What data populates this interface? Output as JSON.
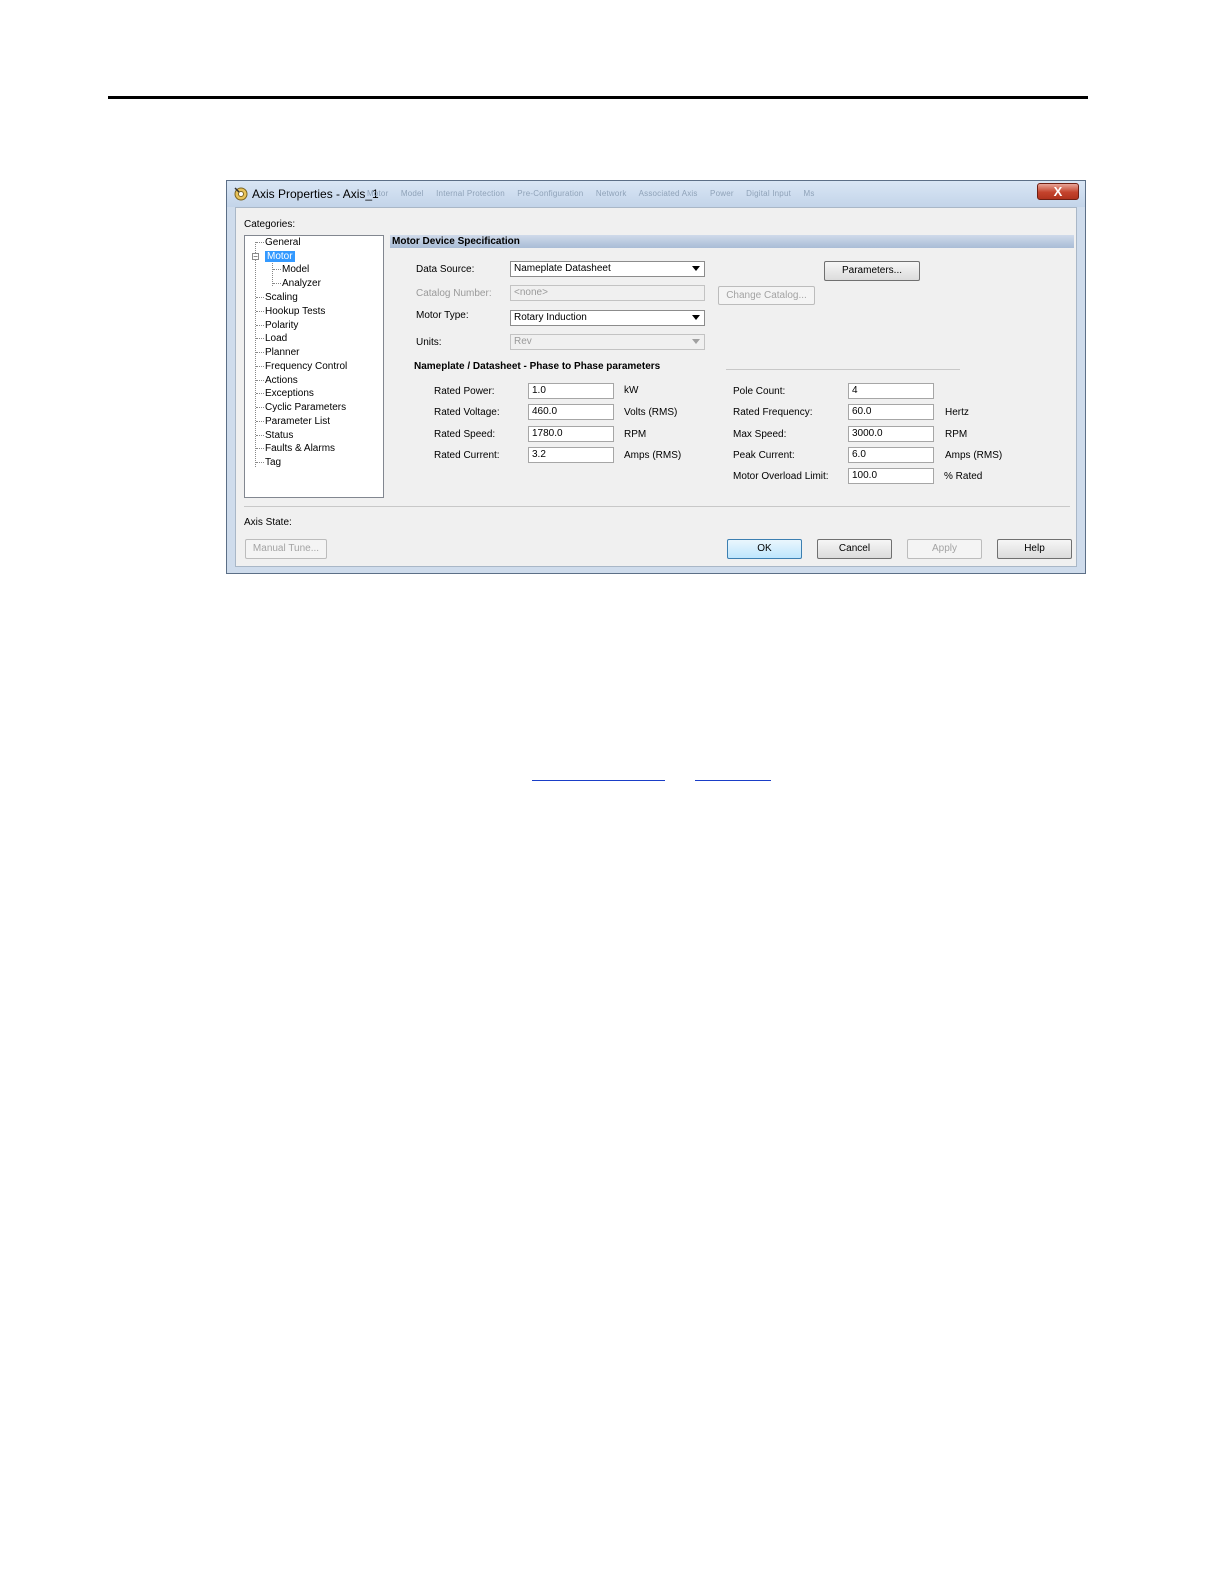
{
  "dialog": {
    "title": "Axis Properties - Axis_1",
    "ghost_tabs": [
      "Motor",
      "Model",
      "Internal Protection",
      "Pre-Configuration",
      "Network",
      "Associated Axis",
      "Power",
      "Digital Input",
      "Ms"
    ],
    "close_label": "X"
  },
  "categories": {
    "label": "Categories:",
    "expander": "−",
    "items": [
      "General",
      "Motor",
      "Model",
      "Analyzer",
      "Scaling",
      "Hookup Tests",
      "Polarity",
      "Load",
      "Planner",
      "Frequency Control",
      "Actions",
      "Exceptions",
      "Cyclic Parameters",
      "Parameter List",
      "Status",
      "Faults & Alarms",
      "Tag"
    ],
    "selected": "Motor"
  },
  "spec": {
    "header": "Motor Device Specification",
    "data_source_label": "Data Source:",
    "data_source_value": "Nameplate Datasheet",
    "catalog_label": "Catalog Number:",
    "catalog_value": "<none>",
    "motor_type_label": "Motor Type:",
    "motor_type_value": "Rotary Induction",
    "units_label": "Units:",
    "units_value": "Rev",
    "parameters_button": "Parameters...",
    "change_catalog_button": "Change Catalog..."
  },
  "nameplate": {
    "heading": "Nameplate / Datasheet - Phase to Phase parameters",
    "left": [
      {
        "label": "Rated Power:",
        "value": "1.0",
        "unit": "kW"
      },
      {
        "label": "Rated Voltage:",
        "value": "460.0",
        "unit": "Volts (RMS)"
      },
      {
        "label": "Rated Speed:",
        "value": "1780.0",
        "unit": "RPM"
      },
      {
        "label": "Rated Current:",
        "value": "3.2",
        "unit": "Amps (RMS)"
      }
    ],
    "right": [
      {
        "label": "Pole Count:",
        "value": "4",
        "unit": ""
      },
      {
        "label": "Rated Frequency:",
        "value": "60.0",
        "unit": "Hertz"
      },
      {
        "label": "Max Speed:",
        "value": "3000.0",
        "unit": "RPM"
      },
      {
        "label": "Peak Current:",
        "value": "6.0",
        "unit": "Amps (RMS)"
      },
      {
        "label": "Motor Overload Limit:",
        "value": "100.0",
        "unit": "% Rated"
      }
    ]
  },
  "footer": {
    "axis_state_label": "Axis State:",
    "manual_tune": "Manual Tune...",
    "ok": "OK",
    "cancel": "Cancel",
    "apply": "Apply",
    "help": "Help"
  }
}
